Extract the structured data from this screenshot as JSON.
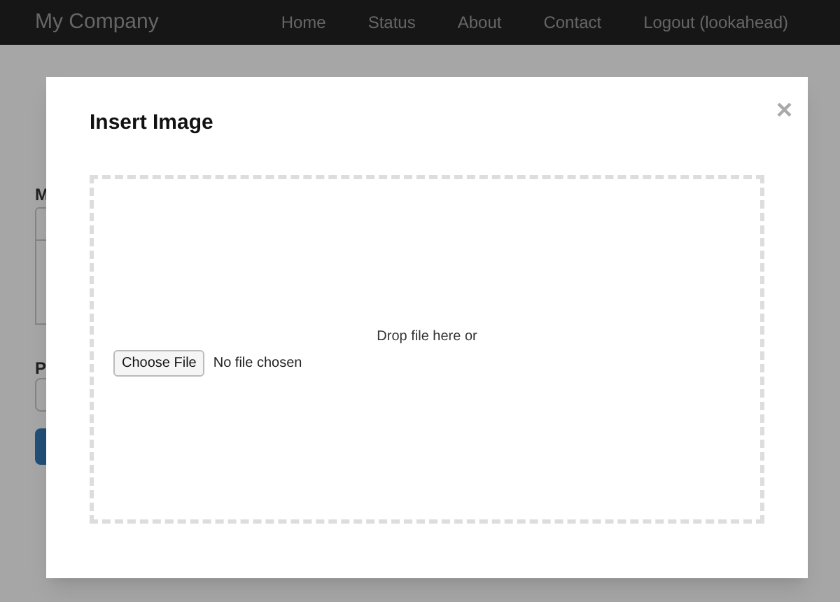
{
  "navbar": {
    "brand": "My Company",
    "links": [
      "Home",
      "Status",
      "About",
      "Contact",
      "Logout (lookahead)"
    ]
  },
  "page": {
    "labels": [
      "M",
      "P"
    ]
  },
  "modal": {
    "title": "Insert Image",
    "close": "×",
    "dropzone": {
      "text": "Drop file here or",
      "button": "Choose File",
      "file_status": "No file chosen"
    }
  }
}
